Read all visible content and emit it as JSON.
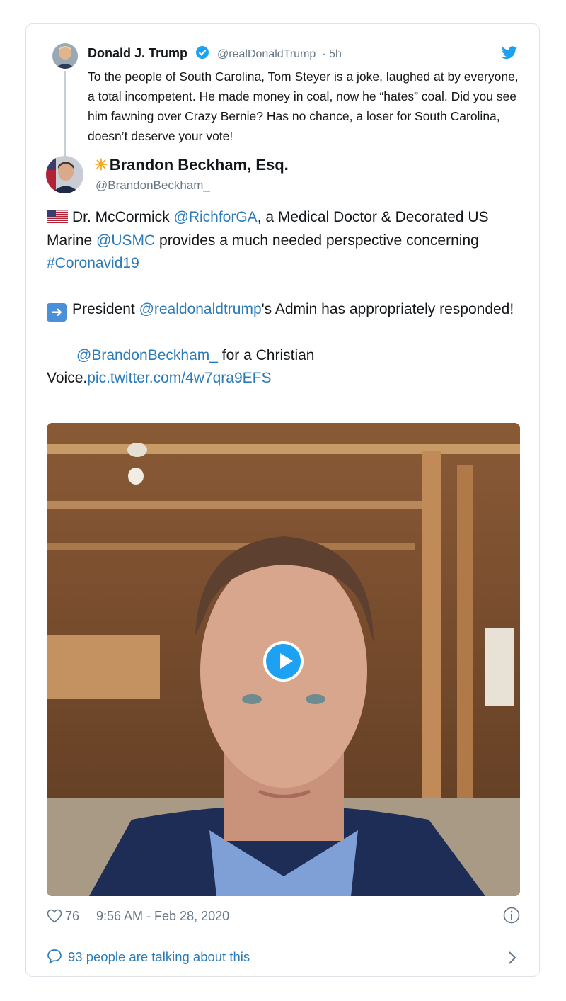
{
  "reply": {
    "name": "Donald J. Trump",
    "handle": "@realDonaldTrump",
    "time": "· 5h",
    "text": "To the people of South Carolina, Tom Steyer is a joke, laughed at by everyone, a total incompetent. He made money in coal, now he “hates” coal. Did you see him fawning over Crazy Bernie? Has no chance, a loser for South Carolina, doesn’t deserve your vote!",
    "verified_icon": "verified-badge-icon",
    "brand_icon": "twitter-bird-icon"
  },
  "tweet": {
    "author_name": "Brandon Beckham, Esq.",
    "author_prefix": "☀",
    "author_handle": "@BrandonBeckham_",
    "line1_pre": "Dr. McCormick ",
    "line1_mention1": "@RichforGA",
    "line1_mid": ", a Medical Doctor & Decorated US Marine ",
    "line1_mention2": "@USMC",
    "line1_post": " provides a much needed perspective concerning ",
    "line1_hashtag": "#Coronavid19",
    "line2_pre": "President ",
    "line2_mention": "@realdonaldtrump",
    "line2_post": "'s Admin has appropriately responded!",
    "line3_mention": "@BrandonBeckham_",
    "line3_post": " for a Christian Voice.",
    "line3_link": "pic.twitter.com/4w7qra9EFS"
  },
  "footer": {
    "likes": "76",
    "timestamp": "9:56 AM - Feb 28, 2020",
    "talking": "93 people are talking about this"
  },
  "colors": {
    "link": "#2b7bb9",
    "muted": "#657786",
    "play": "#1da1f2",
    "border": "#dfe3e8"
  }
}
